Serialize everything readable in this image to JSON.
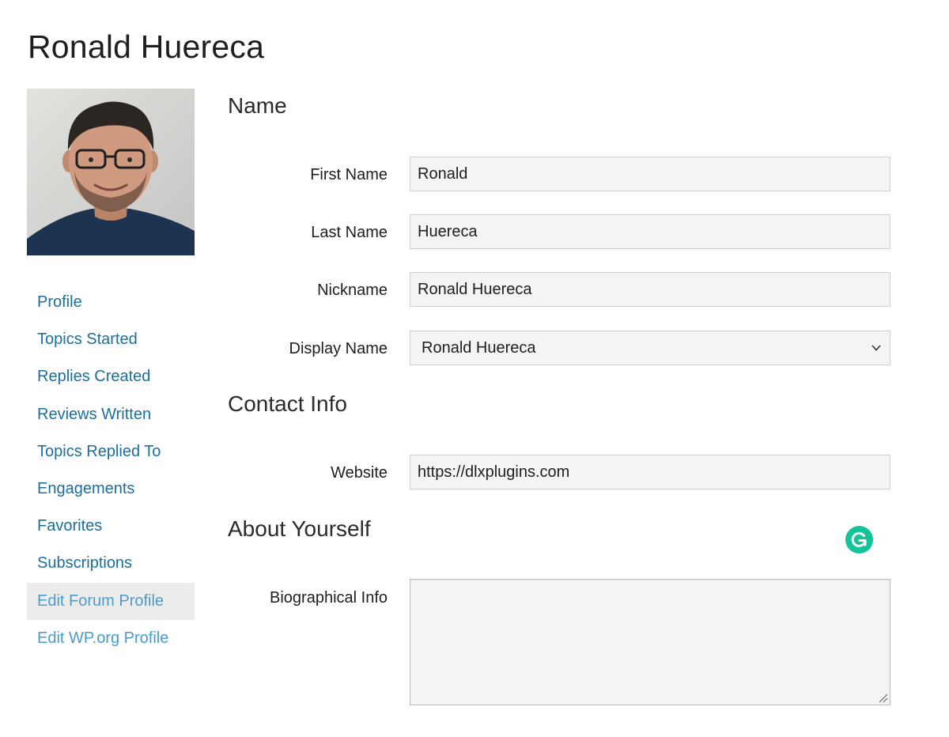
{
  "page": {
    "title": "Ronald Huereca"
  },
  "avatar": {
    "alt": "Ronald Huereca"
  },
  "nav": {
    "items": [
      {
        "label": "Profile"
      },
      {
        "label": "Topics Started"
      },
      {
        "label": "Replies Created"
      },
      {
        "label": "Reviews Written"
      },
      {
        "label": "Topics Replied To"
      },
      {
        "label": "Engagements"
      },
      {
        "label": "Favorites"
      },
      {
        "label": "Subscriptions"
      },
      {
        "label": "Edit Forum Profile",
        "active": true
      },
      {
        "label": "Edit WP.org Profile"
      }
    ]
  },
  "sections": {
    "name": "Name",
    "contact": "Contact Info",
    "about": "About Yourself"
  },
  "fields": {
    "first_name": {
      "label": "First Name",
      "value": "Ronald"
    },
    "last_name": {
      "label": "Last Name",
      "value": "Huereca"
    },
    "nickname": {
      "label": "Nickname",
      "value": "Ronald Huereca"
    },
    "display_name": {
      "label": "Display Name",
      "value": "Ronald Huereca"
    },
    "website": {
      "label": "Website",
      "value": "https://dlxplugins.com"
    },
    "bio": {
      "label": "Biographical Info",
      "value": ""
    }
  },
  "icons": {
    "select_chevron": "chevron-down-icon",
    "grammarly": "grammarly-icon",
    "resize": "resize-grip-icon"
  },
  "colors": {
    "link": "#1c6f9a",
    "active_link": "#4a9ccd",
    "active_bg": "#ececec",
    "field_bg": "#f4f4f4",
    "grammarly": "#15c39a"
  }
}
